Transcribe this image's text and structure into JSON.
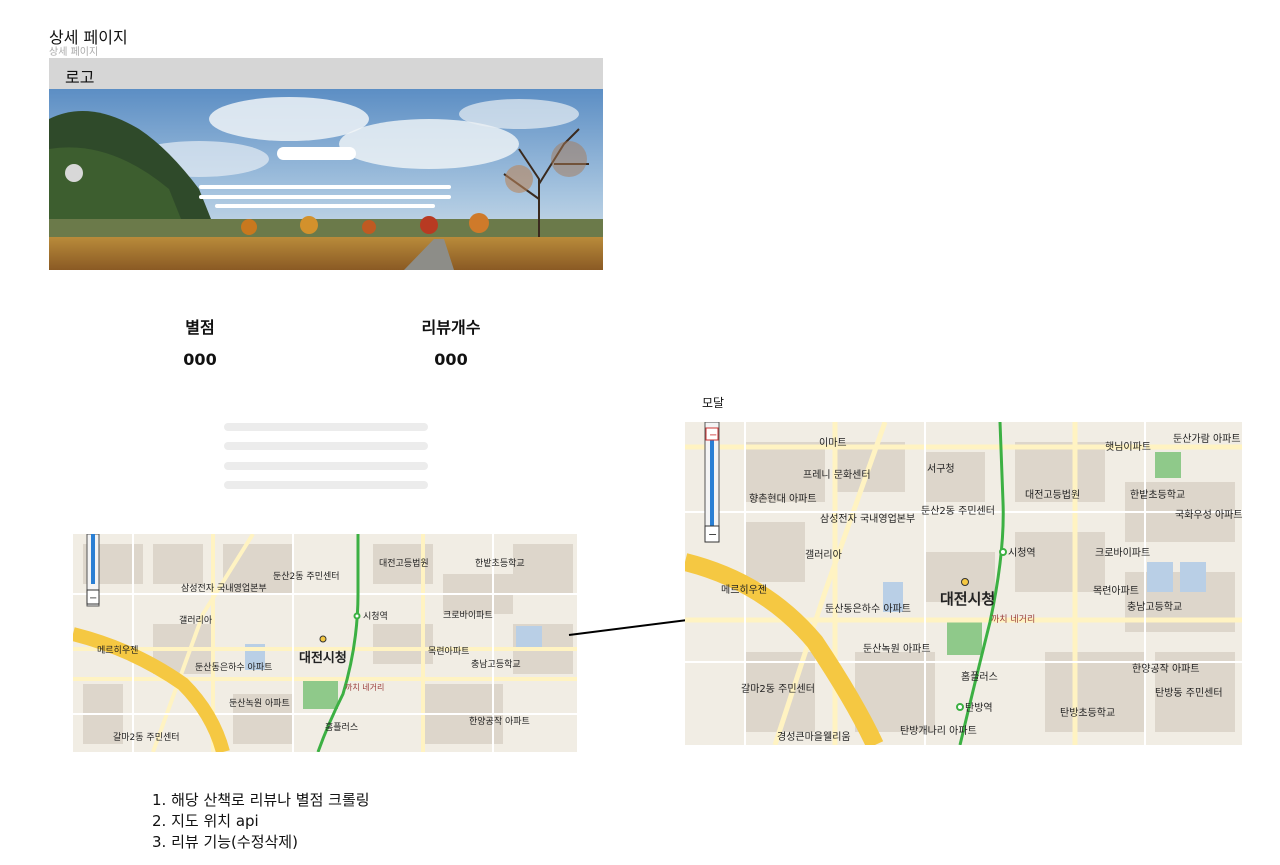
{
  "frame": {
    "title": "상세 페이지",
    "subtitle": "상세 페이지"
  },
  "header": {
    "logo": "로고"
  },
  "stats": [
    {
      "label": "별점",
      "value": "000"
    },
    {
      "label": "리뷰개수",
      "value": "000"
    }
  ],
  "map_labels": {
    "city_hall": "대전시청",
    "cityhall_station": "시청역",
    "tanbang_station": "탄방역",
    "court": "대전고등법원",
    "hanbat_school": "한밭초등학교",
    "crobi": "크로바이파트",
    "mokryeon": "목련아파트",
    "chungnam_high": "충남고등학교",
    "seogu_office": "서구청",
    "dunsan2": "둔산2동 주민센터",
    "samsung": "삼성전자 국내영업본부",
    "galleria": "갤러리아",
    "merehu": "메르히우젠",
    "eunha": "둔산동은하수 아파트",
    "noksu": "둔산녹원 아파트",
    "kachi": "까치 네거리",
    "homeplus": "홈플러스",
    "hanyang": "한양공작 아파트",
    "tanbangdong": "탄방동 주민센터",
    "galma2": "갈마2동 주민센터",
    "frenee": "프레니 문화센터",
    "hyangchon": "향촌현대 아파트",
    "emart": "이마트",
    "hyetnim": "햇님이파트",
    "gukhwa": "국화우성 아파트",
    "tanbang_elem": "탄방초등학교",
    "gyeongseong": "경성큰마을웰리움",
    "tanbang_gaenari": "탄방개나리 아파트",
    "dunsan_garam": "둔산가람 아파트"
  },
  "modal": {
    "label": "모달"
  },
  "notes": [
    "1. 해당 산책로 리뷰나 별점 크롤링",
    "2. 지도 위치 api",
    "3. 리뷰 기능(수정삭제)"
  ],
  "colors": {
    "header_bg": "#d6d6d6",
    "map_bg": "#f1ede4",
    "main_road": "#f5c842",
    "subway_line": "#3cb043",
    "park": "#8fc98a",
    "water": "#b9cfe6"
  }
}
